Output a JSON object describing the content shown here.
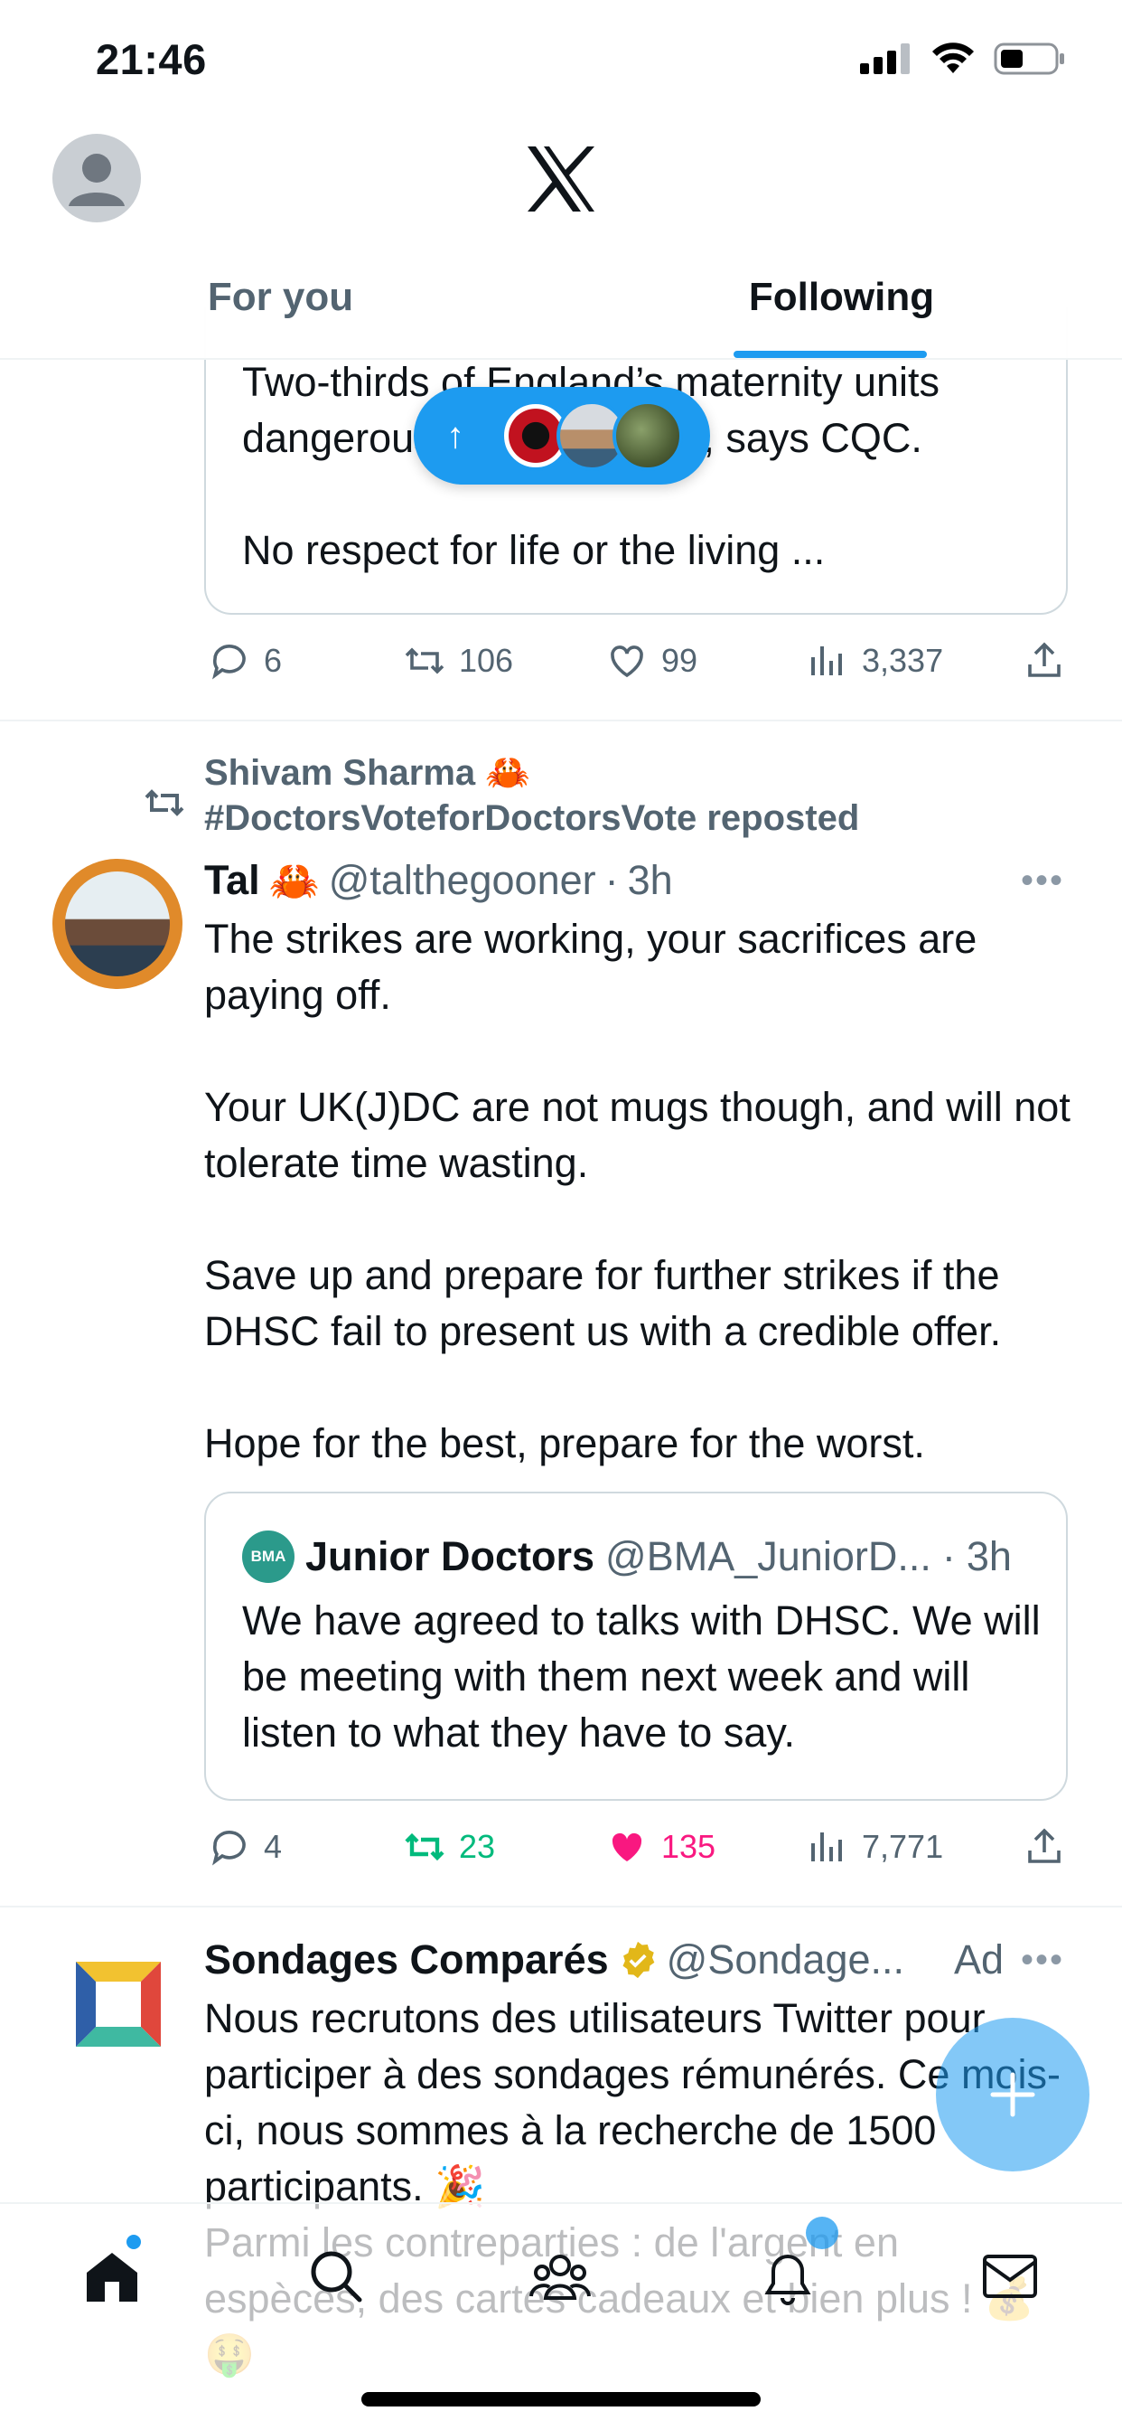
{
  "status_bar": {
    "time": "21:46"
  },
  "header": {
    "tabs": [
      {
        "label": "For you",
        "active": false
      },
      {
        "label": "Following",
        "active": true
      }
    ],
    "accent": "#1d9bf0"
  },
  "top_post": {
    "quote_text": "Two-thirds of England’s maternity units dangerously underfunded, says CQC.\n\nNo respect for life or the living ...",
    "actions": {
      "replies": "6",
      "reposts": "106",
      "likes": "99",
      "views": "3,337"
    }
  },
  "post2": {
    "repost_by": "Shivam Sharma 🦀\n#DoctorsVoteforDoctorsVote reposted",
    "author": {
      "name": "Tal",
      "emoji": "🦀",
      "handle": "@talthegooner",
      "time": "3h"
    },
    "body": "The strikes are working, your sacrifices are paying off.\n\nYour UK(J)DC are not mugs though, and will not tolerate time wasting.\n\nSave up and prepare for further strikes if the DHSC fail to present us with a credible offer.\n\nHope for the best, prepare for the worst.",
    "quote": {
      "logo_text": "BMA",
      "name": "Junior Doctors",
      "handle": "@BMA_JuniorD...",
      "time": "3h",
      "body": "We have agreed to talks with DHSC. We will be meeting with them next week and will listen to what they have to say."
    },
    "actions": {
      "replies": "4",
      "reposts": "23",
      "likes": "135",
      "views": "7,771"
    }
  },
  "ad_post": {
    "name": "Sondages Comparés",
    "handle": "@Sondage...",
    "label": "Ad",
    "body": "Nous recrutons des utilisateurs Twitter pour participer à des sondages rémunérés. Ce mois-ci, nous sommes à la recherche de 1500 participants. 🎉\nParmi les contreparties : de l'argent en espèces, des cartes cadeaux et bien plus ! 💰 🤑"
  },
  "icons": {
    "nav": [
      "home-icon",
      "search-icon",
      "communities-icon",
      "notifications-icon",
      "messages-icon"
    ]
  }
}
